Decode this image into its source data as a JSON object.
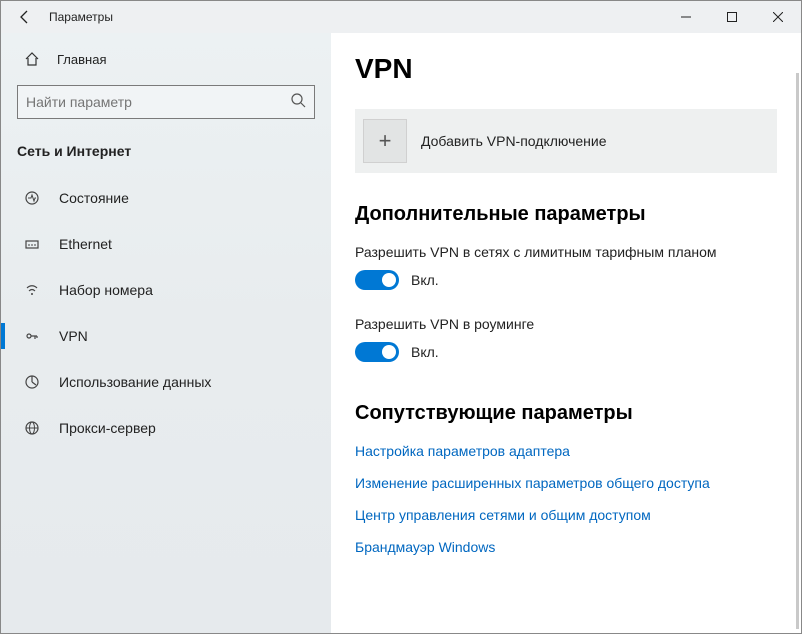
{
  "window": {
    "title": "Параметры"
  },
  "sidebar": {
    "home": "Главная",
    "search_placeholder": "Найти параметр",
    "section": "Сеть и Интернет",
    "items": [
      {
        "label": "Состояние"
      },
      {
        "label": "Ethernet"
      },
      {
        "label": "Набор номера"
      },
      {
        "label": "VPN"
      },
      {
        "label": "Использование данных"
      },
      {
        "label": "Прокси-сервер"
      }
    ]
  },
  "page": {
    "title": "VPN",
    "add_label": "Добавить VPN-подключение",
    "adv_heading": "Дополнительные параметры",
    "opt1_label": "Разрешить VPN в сетях с лимитным тарифным планом",
    "opt1_state": "Вкл.",
    "opt2_label": "Разрешить VPN в роуминге",
    "opt2_state": "Вкл.",
    "related_heading": "Сопутствующие параметры",
    "links": [
      "Настройка параметров адаптера",
      "Изменение расширенных параметров общего доступа",
      "Центр управления сетями и общим доступом",
      "Брандмауэр Windows"
    ]
  }
}
